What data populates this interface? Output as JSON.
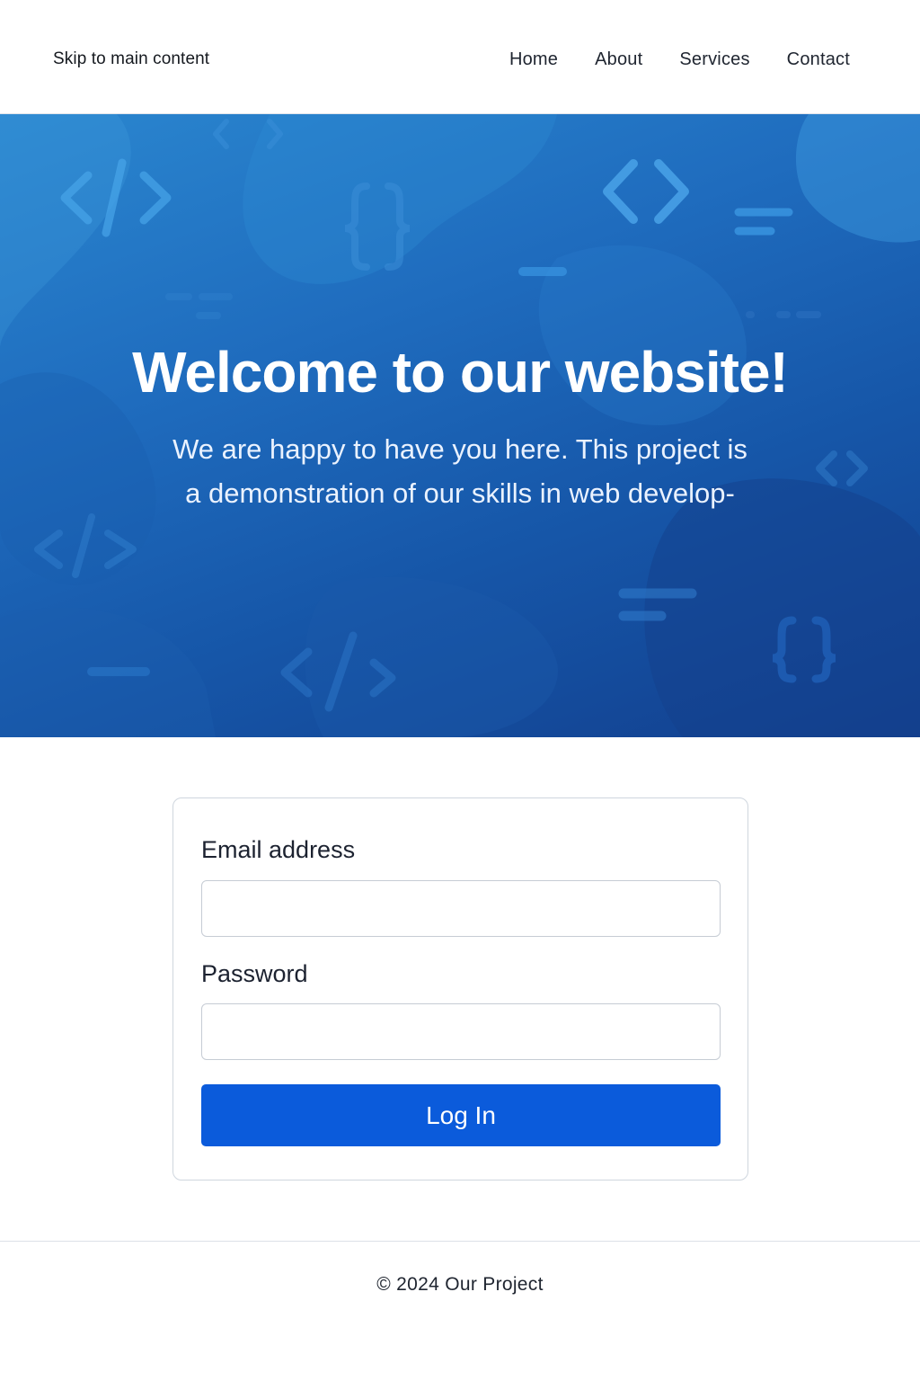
{
  "header": {
    "skip_link": "Skip to main content",
    "nav": [
      "Home",
      "About",
      "Services",
      "Contact"
    ]
  },
  "hero": {
    "title": "Welcome to our website!",
    "text_line1": "We are happy to have you here. This project is",
    "text_line2": "a demonstration of our skills in web develop-"
  },
  "login": {
    "email_label": "Email address",
    "email_value": "",
    "password_label": "Password",
    "password_value": "",
    "submit_label": "Log In"
  },
  "footer": {
    "copyright": "© 2024 Our Project"
  },
  "colors": {
    "hero_start": "#2a86cf",
    "hero_end": "#123f8e",
    "button": "#0b5bdb",
    "border": "#cfd6de"
  },
  "icons": [
    "code-tag-icon",
    "curly-braces-icon",
    "angle-brackets-icon",
    "text-lines-icon"
  ]
}
